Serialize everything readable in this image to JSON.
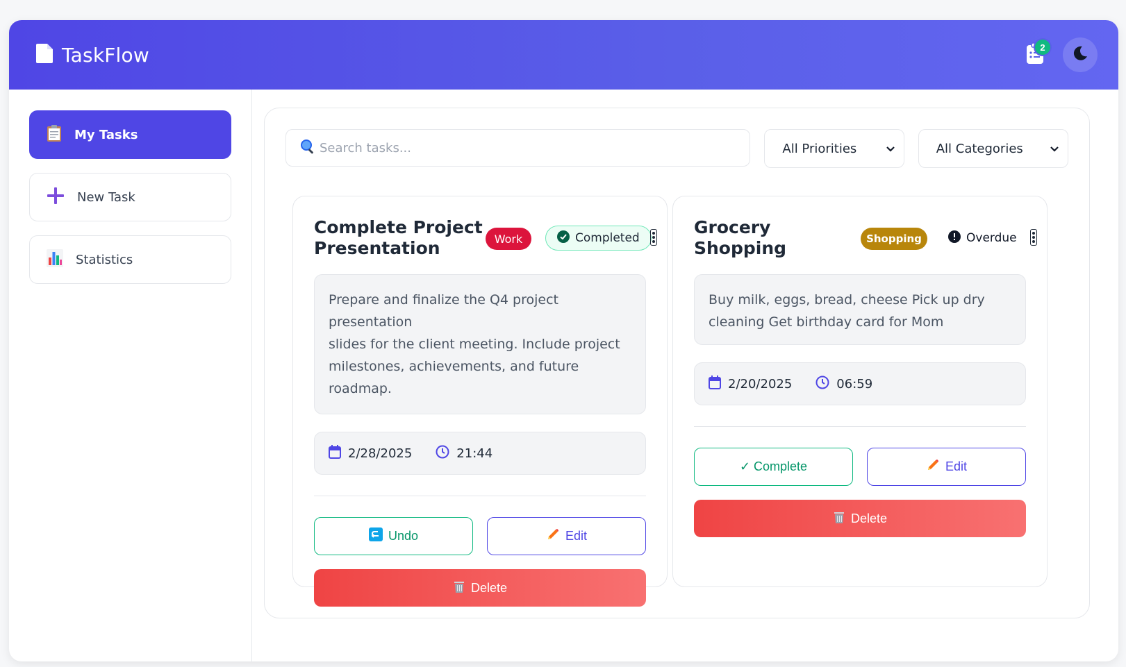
{
  "app": {
    "title": "TaskFlow",
    "notification_count": "2"
  },
  "colors": {
    "primary": "#4f46e5",
    "success": "#10b981",
    "danger": "#ef4444",
    "work_tag": "#dc143c",
    "shopping_tag": "#b8860b"
  },
  "sidebar": {
    "items": [
      {
        "label": "My Tasks",
        "icon": "clipboard-icon",
        "active": true
      },
      {
        "label": "New Task",
        "icon": "plus-icon",
        "active": false
      },
      {
        "label": "Statistics",
        "icon": "bar-chart-icon",
        "active": false
      }
    ]
  },
  "filters": {
    "search_placeholder": "Search tasks...",
    "priority_selected": "All Priorities",
    "category_selected": "All Categories"
  },
  "tasks": [
    {
      "title_line1": "Complete Project",
      "title_line2": "Presentation",
      "category": "Work",
      "status": "Completed",
      "description_lines": [
        "Prepare and finalize the Q4 project presentation",
        "slides for the client meeting. Include project",
        "milestones, achievements, and future roadmap."
      ],
      "date": "2/28/2025",
      "time": "21:44",
      "primary_action": "Undo",
      "edit_label": "Edit",
      "delete_label": "Delete"
    },
    {
      "title_line1": "Grocery",
      "title_line2": "Shopping",
      "category": "Shopping",
      "status": "Overdue",
      "description_lines": [
        "Buy milk, eggs, bread, cheese Pick up dry",
        "cleaning Get birthday card for Mom"
      ],
      "date": "2/20/2025",
      "time": "06:59",
      "primary_action": "✓ Complete",
      "edit_label": "Edit",
      "delete_label": "Delete"
    }
  ]
}
